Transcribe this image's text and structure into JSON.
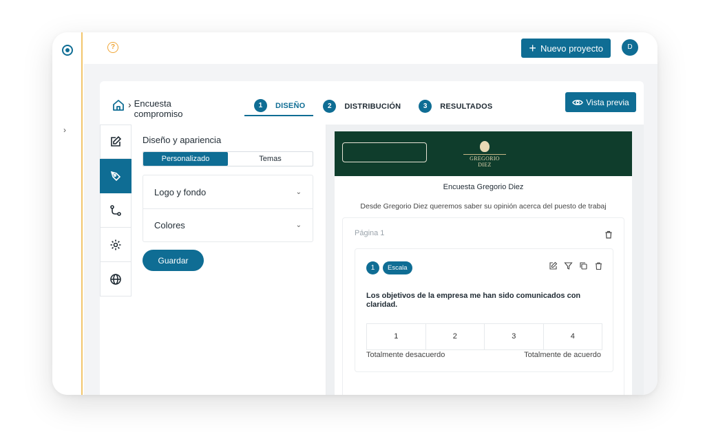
{
  "topbar": {
    "new_project_label": "Nuevo proyecto",
    "avatar_initial": "D"
  },
  "breadcrumb": {
    "title": "Encuesta compromiso"
  },
  "steps": [
    {
      "number": "1",
      "label": "DISEÑO",
      "active": true
    },
    {
      "number": "2",
      "label": "DISTRIBUCIÓN",
      "active": false
    },
    {
      "number": "3",
      "label": "RESULTADOS",
      "active": false
    }
  ],
  "preview_button_label": "Vista previa",
  "tools": [
    {
      "icon": "edit-icon",
      "active": false
    },
    {
      "icon": "brush-pen-icon",
      "active": true
    },
    {
      "icon": "route-icon",
      "active": false
    },
    {
      "icon": "gear-icon",
      "active": false
    },
    {
      "icon": "globe-icon",
      "active": false
    }
  ],
  "settings": {
    "title": "Diseño y apariencia",
    "tabs": [
      "Personalizado",
      "Temas"
    ],
    "sections": [
      "Logo y fondo",
      "Colores"
    ],
    "save_label": "Guardar"
  },
  "preview": {
    "brand_name": "GREGORIO DIEZ",
    "survey_title": "Encuesta Gregorio Diez",
    "survey_description": "Desde Gregorio Diez queremos saber su opinión acerca del puesto de trabaj",
    "page_label": "Página 1",
    "question": {
      "number": "1",
      "type_badge": "Escala",
      "text": "Los objetivos de la empresa me han sido comunicados con claridad.",
      "scale": [
        "1",
        "2",
        "3",
        "4"
      ],
      "min_label": "Totalmente desacuerdo",
      "max_label": "Totalmente de acuerdo"
    }
  },
  "colors": {
    "primary": "#0f6d94",
    "banner": "#0f3d2c",
    "accent_rail": "#f2c56b",
    "help_icon": "#f0a535"
  }
}
